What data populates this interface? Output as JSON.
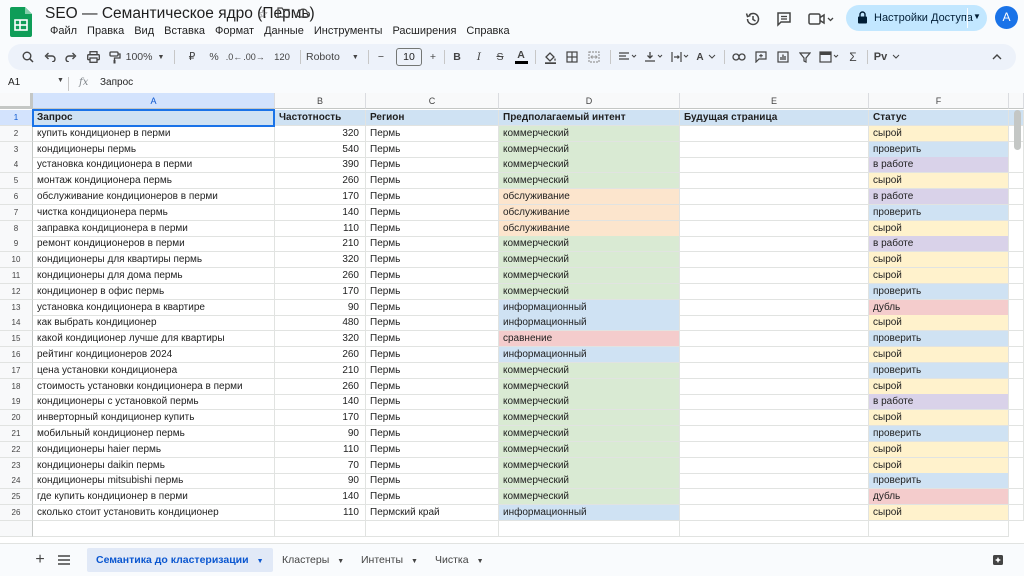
{
  "app": {
    "title": "SEO — Семантическое ядро (Пермь)",
    "menu": [
      "Файл",
      "Правка",
      "Вид",
      "Вставка",
      "Формат",
      "Данные",
      "Инструменты",
      "Расширения",
      "Справка"
    ],
    "share_label": "Настройки Доступа",
    "avatar_letter": "A"
  },
  "toolbar": {
    "zoom": "100%",
    "percent": "%",
    "decimals": "120",
    "font": "Roboto",
    "font_size": "10",
    "bold": "B",
    "italic": "I",
    "strike": "S",
    "underline_a": "A",
    "sigma": "Σ",
    "input_tools": "Рv",
    "minus": "−",
    "plus": "+"
  },
  "formula_bar": {
    "cell_ref": "A1",
    "fx": "fx",
    "content": "Запрос"
  },
  "columns": [
    "A",
    "B",
    "C",
    "D",
    "E",
    "F"
  ],
  "headers": [
    "Запрос",
    "Частотность",
    "Регион",
    "Предполагаемый интент",
    "Будущая страница",
    "Статус"
  ],
  "rows": [
    [
      "купить кондиционер в перми",
      "320",
      "Пермь",
      "коммерческий",
      "",
      "сырой"
    ],
    [
      "кондиционеры пермь",
      "540",
      "Пермь",
      "коммерческий",
      "",
      "проверить"
    ],
    [
      "установка кондиционера в перми",
      "390",
      "Пермь",
      "коммерческий",
      "",
      "в работе"
    ],
    [
      "монтаж кондиционера пермь",
      "260",
      "Пермь",
      "коммерческий",
      "",
      "сырой"
    ],
    [
      "обслуживание кондиционеров в перми",
      "170",
      "Пермь",
      "обслуживание",
      "",
      "в работе"
    ],
    [
      "чистка кондиционера пермь",
      "140",
      "Пермь",
      "обслуживание",
      "",
      "проверить"
    ],
    [
      "заправка кондиционера в перми",
      "110",
      "Пермь",
      "обслуживание",
      "",
      "сырой"
    ],
    [
      "ремонт кондиционеров в перми",
      "210",
      "Пермь",
      "коммерческий",
      "",
      "в работе"
    ],
    [
      "кондиционеры для квартиры пермь",
      "320",
      "Пермь",
      "коммерческий",
      "",
      "сырой"
    ],
    [
      "кондиционеры для дома пермь",
      "260",
      "Пермь",
      "коммерческий",
      "",
      "сырой"
    ],
    [
      "кондиционер в офис пермь",
      "170",
      "Пермь",
      "коммерческий",
      "",
      "проверить"
    ],
    [
      "установка кондиционера в квартире",
      "90",
      "Пермь",
      "информационный",
      "",
      "дубль"
    ],
    [
      "как выбрать кондиционер",
      "480",
      "Пермь",
      "информационный",
      "",
      "сырой"
    ],
    [
      "какой кондиционер лучше для квартиры",
      "320",
      "Пермь",
      "сравнение",
      "",
      "проверить"
    ],
    [
      "рейтинг кондиционеров 2024",
      "260",
      "Пермь",
      "информационный",
      "",
      "сырой"
    ],
    [
      "цена установки кондиционера",
      "210",
      "Пермь",
      "коммерческий",
      "",
      "проверить"
    ],
    [
      "стоимость установки кондиционера в перми",
      "260",
      "Пермь",
      "коммерческий",
      "",
      "сырой"
    ],
    [
      "кондиционеры с установкой пермь",
      "140",
      "Пермь",
      "коммерческий",
      "",
      "в работе"
    ],
    [
      "инверторный кондиционер купить",
      "170",
      "Пермь",
      "коммерческий",
      "",
      "сырой"
    ],
    [
      "мобильный кондиционер пермь",
      "90",
      "Пермь",
      "коммерческий",
      "",
      "проверить"
    ],
    [
      "кондиционеры haier пермь",
      "110",
      "Пермь",
      "коммерческий",
      "",
      "сырой"
    ],
    [
      "кондиционеры daikin пермь",
      "70",
      "Пермь",
      "коммерческий",
      "",
      "сырой"
    ],
    [
      "кондиционеры mitsubishi пермь",
      "90",
      "Пермь",
      "коммерческий",
      "",
      "проверить"
    ],
    [
      "где купить кондиционер в перми",
      "140",
      "Пермь",
      "коммерческий",
      "",
      "дубль"
    ],
    [
      "сколько стоит установить кондиционер",
      "110",
      "Пермский край",
      "информационный",
      "",
      "сырой"
    ]
  ],
  "intent_colors": {
    "коммерческий": "#d9ead3",
    "обслуживание": "#fce5cd",
    "информационный": "#cfe2f3",
    "сравнение": "#f4cccc"
  },
  "status_colors": {
    "сырой": "#fff2cc",
    "проверить": "#cfe2f3",
    "в работе": "#d9d2e9",
    "дубль": "#f4cccc"
  },
  "header_color": "#cfe2f3",
  "sheets": [
    {
      "label": "Семантика до кластеризации",
      "active": true
    },
    {
      "label": "Кластеры",
      "active": false
    },
    {
      "label": "Интенты",
      "active": false
    },
    {
      "label": "Чистка",
      "active": false
    }
  ]
}
